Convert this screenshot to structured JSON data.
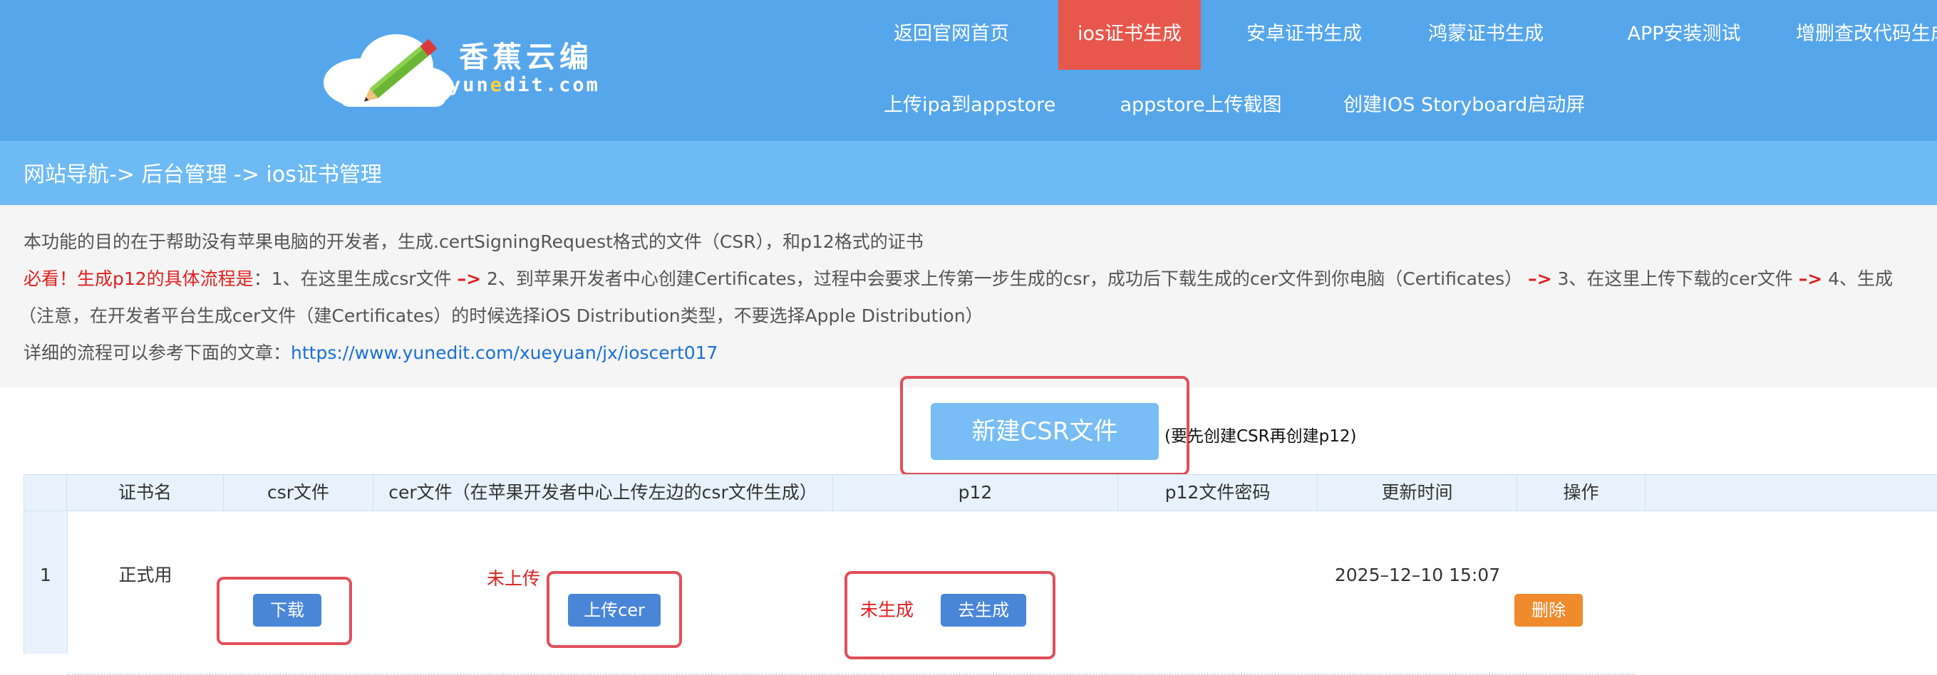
{
  "brand": {
    "title": "香蕉云编",
    "domain_before": "yun",
    "domain_accent": "e",
    "domain_after": "dit.com"
  },
  "nav": {
    "row1": [
      "返回官网首页",
      "ios证书生成",
      "安卓证书生成",
      "鸿蒙证书生成",
      "APP安装测试",
      "增删查改代码生成"
    ],
    "row2": [
      "上传ipa到appstore",
      "appstore上传截图",
      "创建IOS Storyboard启动屏"
    ],
    "active": "ios证书生成"
  },
  "breadcrumb": "网站导航-> 后台管理 -> ios证书管理",
  "info": {
    "line1": "本功能的目的在于帮助没有苹果电脑的开发者，生成.certSigningRequest格式的文件（CSR），和p12格式的证书",
    "line2_red": "必看！生成p12的具体流程是",
    "line2_a": "：1、在这里生成csr文件 ",
    "arrow": "–>",
    "line2_b": " 2、到苹果开发者中心创建Certificates，过程中会要求上传第一步生成的csr，成功后下载生成的cer文件到你电脑（Certificates） ",
    "line2_c": " 3、在这里上传下载的cer文件 ",
    "line2_d": " 4、生成",
    "line3": "（注意，在开发者平台生成cer文件（建Certificates）的时候选择iOS Distribution类型，不要选择Apple Distribution）",
    "line4_label": "详细的流程可以参考下面的文章：",
    "line4_link": "https://www.yunedit.com/xueyuan/jx/ioscert017"
  },
  "actions": {
    "new_csr_label": "新建CSR文件",
    "hint": "(要先创建CSR再创建p12)"
  },
  "table": {
    "headers": [
      "证书名",
      "csr文件",
      "cer文件（在苹果开发者中心上传左边的csr文件生成）",
      "p12",
      "p12文件密码",
      "更新时间",
      "操作"
    ],
    "rows": [
      {
        "index": "1",
        "name": "正式用",
        "csr_button": "下载",
        "cer_status": "未上传",
        "cer_button": "上传cer",
        "p12_status": "未生成",
        "p12_button": "去生成",
        "p12_password": "",
        "updated": "2025–12–10 15:07",
        "delete_button": "删除"
      }
    ]
  },
  "colors": {
    "header_bg": "#56a6ec",
    "breadcrumb_bg": "#6ebaf4",
    "active_nav": "#e8574b",
    "highlight_border": "#e0505a",
    "button_blue": "#4a86d8",
    "button_orange": "#ef8b2c"
  }
}
